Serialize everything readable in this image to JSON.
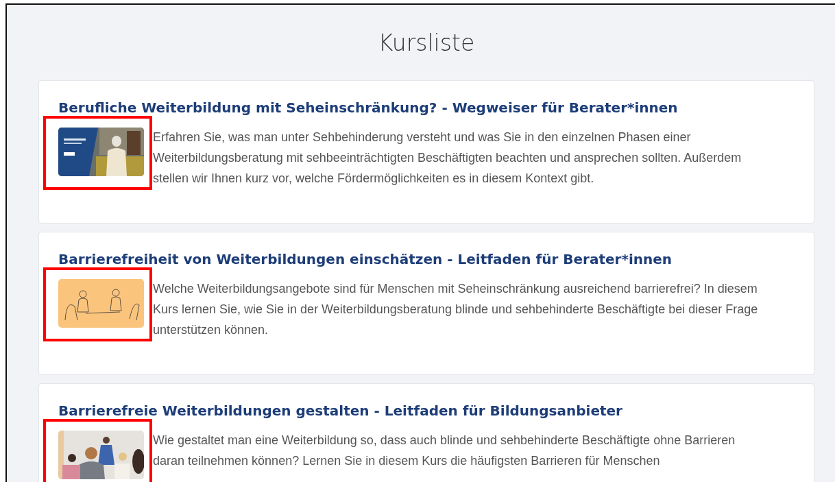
{
  "page": {
    "title": "Kursliste"
  },
  "courses": [
    {
      "title": "Berufliche Weiterbildung mit Seheinschränkung? - Wegweiser für Berater*innen",
      "highlighted": true,
      "description": "Erfahren Sie, was man unter Sehbehinderung versteht und was Sie in den einzelnen Phasen einer Weiterbildungsberatung mit sehbeeinträchtigten Beschäftigten beachten und ansprechen sollten. Außerdem stellen wir Ihnen kurz vor, welche Fördermöglichkeiten es in diesem Kontext gibt."
    },
    {
      "title": "Barrierefreiheit von Weiterbildungen einschätzen - Leitfaden für Berater*innen",
      "highlighted": true,
      "description": "Welche Weiterbildungsangebote sind für Menschen mit Seheinschränkung ausreichend barrierefrei? In diesem Kurs lernen Sie, wie Sie in der Weiterbildungsberatung blinde und sehbehinderte Beschäftigte bei dieser Frage unterstützen können."
    },
    {
      "title": "Barrierefreie Weiterbildungen gestalten - Leitfaden für Bildungsanbieter",
      "highlighted": true,
      "description": "Wie gestaltet man eine Weiterbildung so, dass auch blinde und sehbehinderte Beschäftigte ohne Barrieren daran teilnehmen können? Lernen Sie in diesem Kurs die häufigsten Barrieren für Menschen"
    }
  ]
}
